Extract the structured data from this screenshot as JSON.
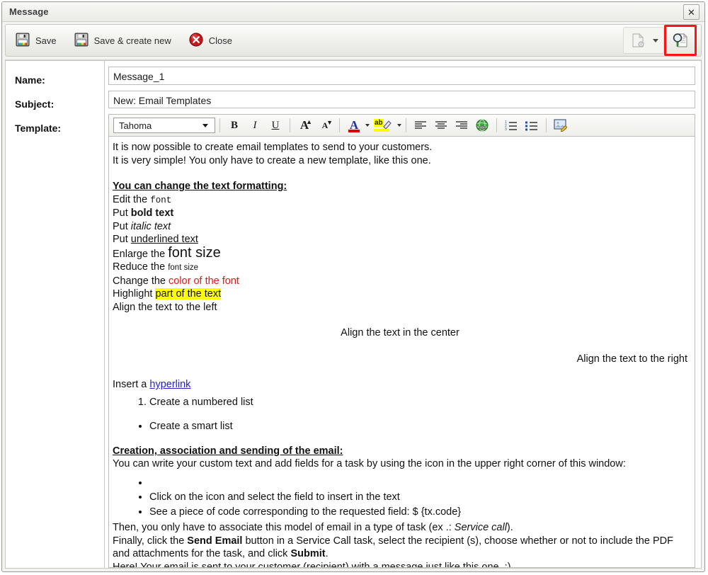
{
  "window": {
    "title": "Message",
    "close_icon": "close-icon",
    "close_label": "✕"
  },
  "toolbar": {
    "buttons": [
      {
        "label": "Save",
        "icon": "floppy-disk-icon"
      },
      {
        "label": "Save & create new",
        "icon": "floppy-disk-icon"
      },
      {
        "label": "Close",
        "icon": "red-x-circle-icon"
      }
    ],
    "right_buttons": [
      {
        "name": "insert-field-dropdown",
        "icon": "document-gear-icon",
        "highlighted": false
      },
      {
        "name": "preview-fields-button",
        "icon": "magnifier-document-icon",
        "highlighted": true
      }
    ],
    "highlight_color": "#ff1414"
  },
  "form": {
    "name": {
      "label": "Name:",
      "value": "Message_1"
    },
    "subject": {
      "label": "Subject:",
      "value": "New: Email Templates"
    },
    "template": {
      "label": "Template:"
    }
  },
  "editor_toolbar": {
    "font": {
      "selected": "Tahoma"
    },
    "bold": "B",
    "italic": "I",
    "underline": "U",
    "increase_font": "A",
    "decrease_font": "A",
    "font_color": "A",
    "highlight_color_label": "ab",
    "align_left": "align-left-icon",
    "align_center": "align-center-icon",
    "align_right": "align-right-icon",
    "hyperlink": "globe-link-icon",
    "numbered_list": "numbered-list-icon",
    "bullet_list": "bullet-list-icon",
    "source_edit": "image-edit-icon",
    "colors": {
      "font_color_bar": "#dd0000",
      "highlight_bar": "#ffff00"
    }
  },
  "message_body": {
    "intro_line1": "It is now possible to create email templates to send to your customers.",
    "intro_line2": "It is very simple! You only have to create a new template, like this one.",
    "heading_formatting": "You can change the text formatting:",
    "edit_font_prefix": "Edit the ",
    "edit_font_word": "font",
    "bold_prefix": "Put ",
    "bold_word": "bold text",
    "italic_prefix": "Put ",
    "italic_word": "italic text",
    "underline_prefix": "Put ",
    "underline_word": "underlined text",
    "enlarge_prefix": "Enlarge the ",
    "enlarge_word": "font size",
    "reduce_prefix": "Reduce the ",
    "reduce_word": "font size",
    "color_prefix": "Change the ",
    "color_word": "color of the font",
    "highlight_prefix": "Highlight ",
    "highlight_word": "part of the text",
    "align_left_text": "Align the text to the left",
    "align_center_text": "Align the text in the center",
    "align_right_text": "Align the text to the right",
    "hyperlink_prefix": "Insert a ",
    "hyperlink_word": "hyperlink",
    "numbered_item": "Create a numbered list",
    "bullet_item": "Create a smart list",
    "heading_creation": "Creation, association and sending of the email:",
    "creation_line": "You can write your custom text and add fields for a task by using the icon in the upper right corner of this window:",
    "bullet_empty": "",
    "bullet_click": "Click on the icon and select the field to insert in the text",
    "bullet_code": "See a piece of code corresponding to the requested field: $ {tx.code}",
    "then_prefix": "Then, you only have to associate this model of email in a type of task (ex .: ",
    "then_italic": "Service call",
    "then_suffix": ").",
    "finally_prefix": "Finally, click the ",
    "finally_bold1": "Send Email",
    "finally_mid": " button in a Service Call task, select the recipient (s), choose whether or not to include the PDF and attachments for the task, and click ",
    "finally_bold2": "Submit",
    "finally_suffix": ".",
    "closing": "Here! Your email is sent to your customer (recipient) with a message just like this one. :)"
  }
}
